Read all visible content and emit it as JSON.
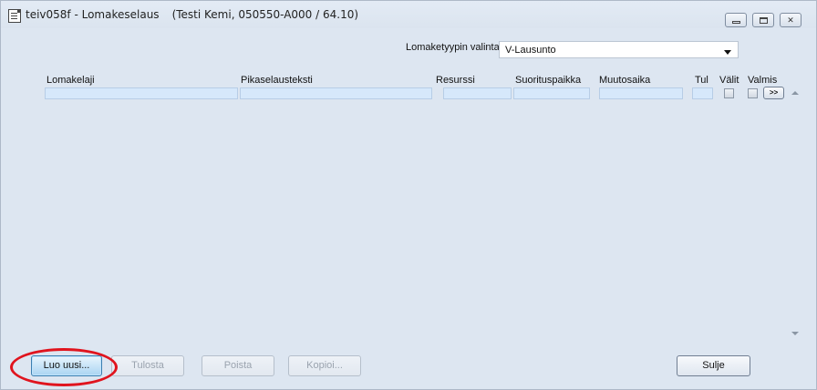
{
  "window": {
    "title": "teiv058f - Lomakeselaus",
    "subtitle": "(Testi Kemi, 050550-A000 / 64.10)"
  },
  "filter": {
    "label": "Lomaketyypin valinta",
    "selected": "V-Lausunto"
  },
  "grid": {
    "columns": [
      "Lomakelaji",
      "Pikaselausteksti",
      "Resurssi",
      "Suorituspaikka",
      "Muutosaika",
      "Tul",
      "Välit",
      "Valmis"
    ],
    "more_label": ">>"
  },
  "buttons": {
    "new": "Luo uusi...",
    "print": "Tulosta",
    "delete": "Poista",
    "copy": "Kopioi...",
    "close": "Sulje"
  },
  "colors": {
    "background": "#dde6f1",
    "cell": "#d6e8fb",
    "highlight": "#e0141e"
  },
  "icons": [
    "document-icon",
    "minimize-icon",
    "maximize-icon",
    "close-icon",
    "dropdown-arrow-icon",
    "scroll-up-icon",
    "scroll-down-icon"
  ]
}
